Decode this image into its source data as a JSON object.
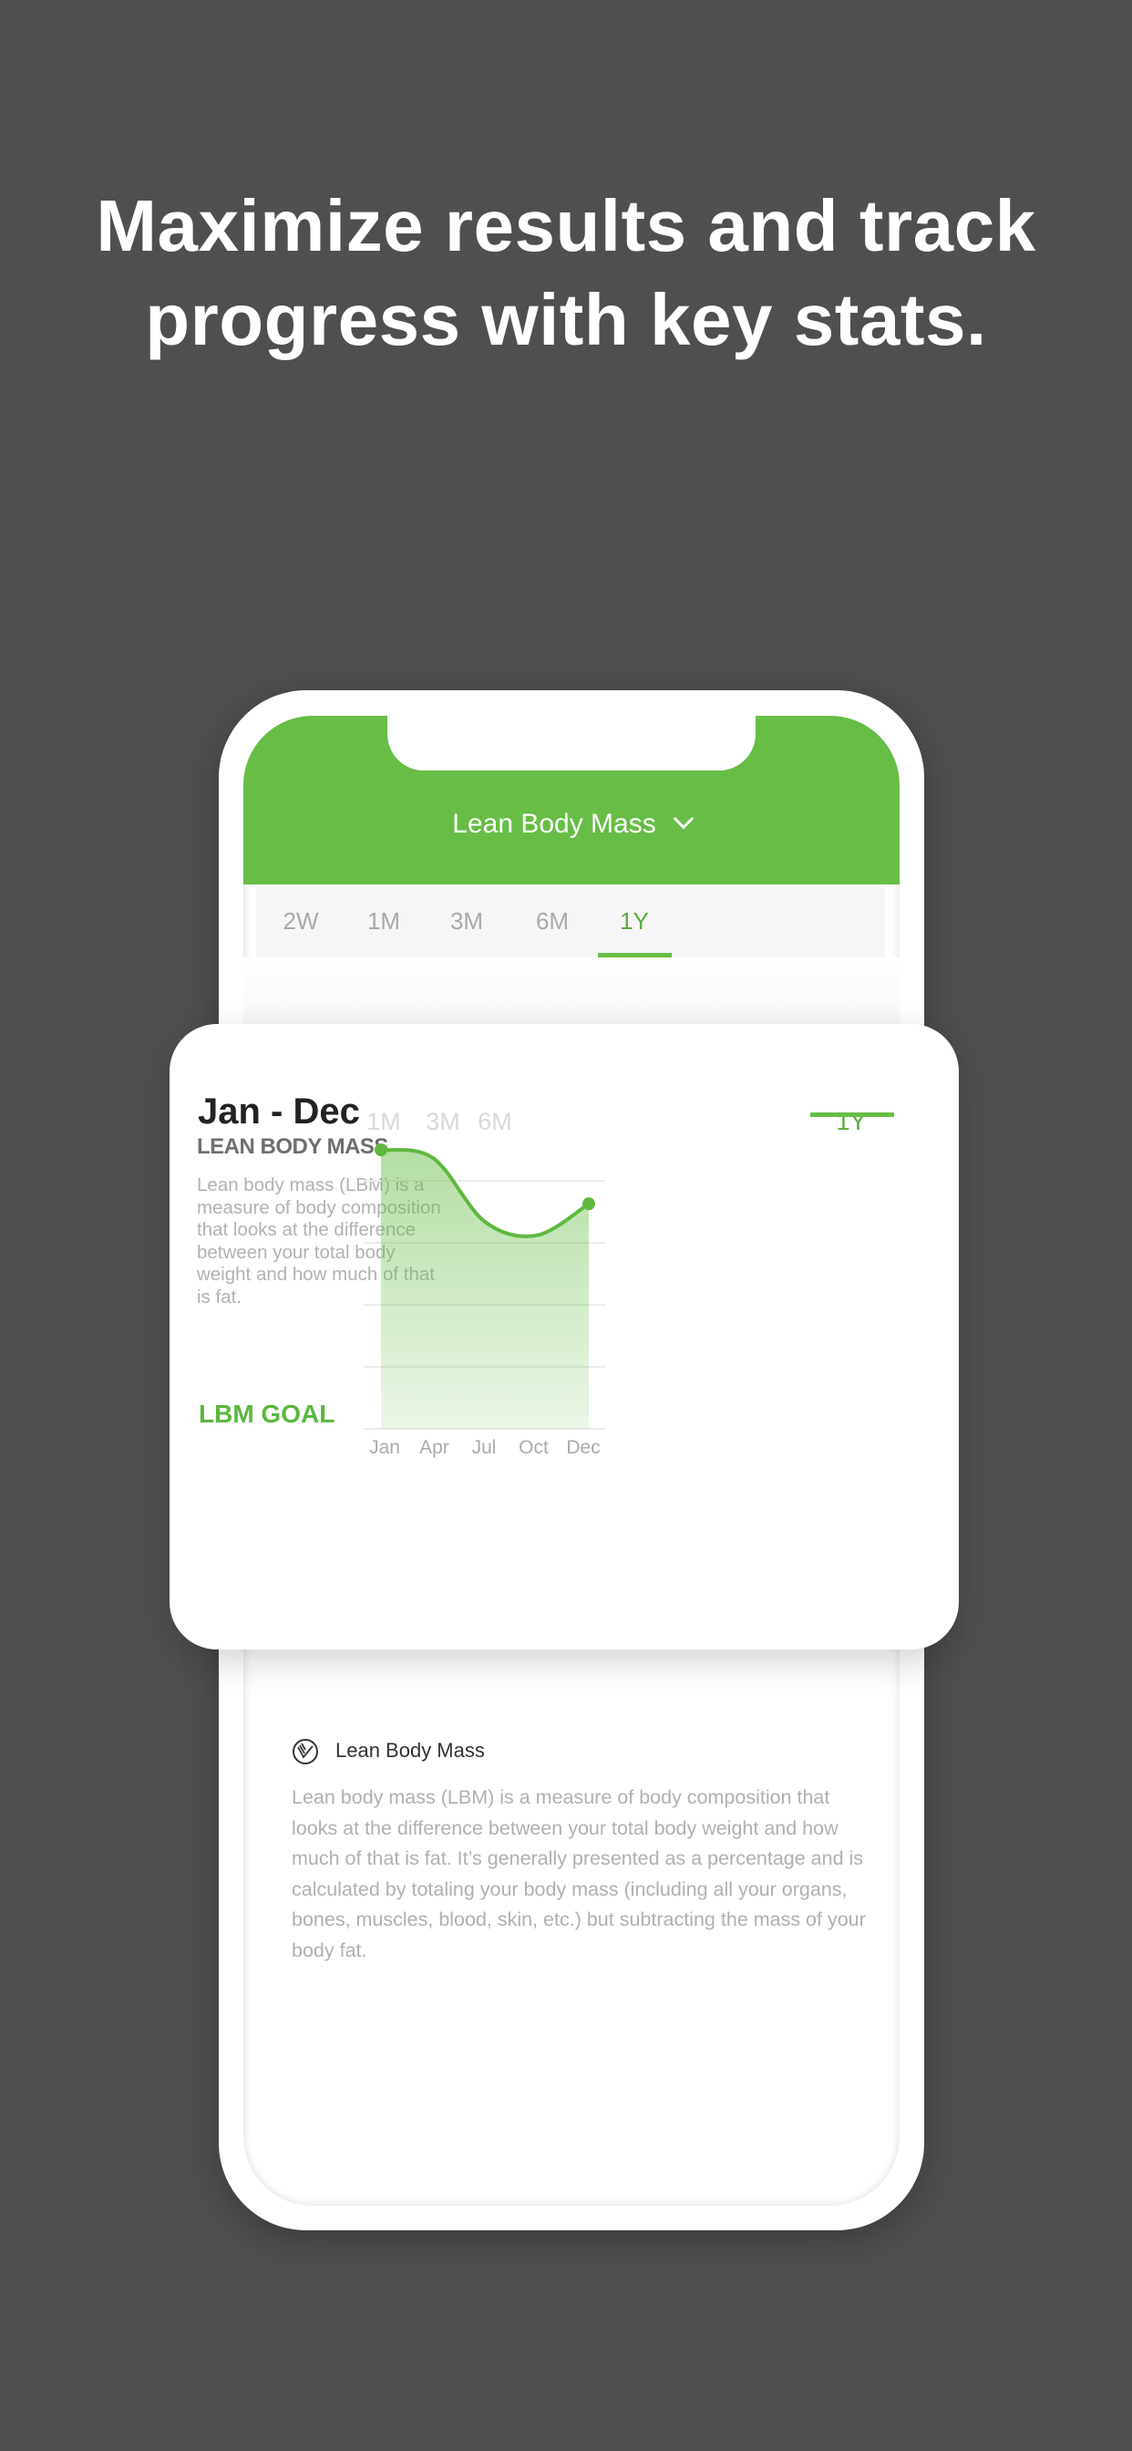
{
  "headline": "Maximize results and track progress with key stats.",
  "header": {
    "title": "Lean Body Mass",
    "dropdown_icon": "chevron-down-icon",
    "accent": "#67bd46"
  },
  "tabs": [
    {
      "label": "2W"
    },
    {
      "label": "1M"
    },
    {
      "label": "3M"
    },
    {
      "label": "6M"
    },
    {
      "label": "1Y",
      "active": true
    }
  ],
  "card": {
    "range": "Jan - Dec",
    "tabs": [
      {
        "label": "1M"
      },
      {
        "label": "3M"
      },
      {
        "label": "6M"
      },
      {
        "label": "1Y",
        "active": true
      }
    ],
    "metric_title": "LEAN BODY MASS",
    "metric_text": "Lean body mass (LBM) is a measure of body composition that looks at the difference between your total body weight and how much of that is fat.",
    "goal_label": "LBM GOAL"
  },
  "chart_data": {
    "type": "area",
    "categories": [
      "Jan",
      "Apr",
      "Jul",
      "Oct",
      "Dec"
    ],
    "values": [
      4.5,
      4.37,
      3.34,
      3.12,
      3.63
    ],
    "ylim": [
      0,
      4.6
    ],
    "grid": true,
    "y_tick_labels_shown": false,
    "color": "#67bd46"
  },
  "info": {
    "icon": "lean-body-mass-icon",
    "title": "Lean Body Mass",
    "text": "Lean body mass (LBM) is a measure of body composition that looks at the difference between your total body weight and how much of that is fat. It’s generally presented as a percentage and is calculated by totaling your body mass (including all your organs, bones, muscles, blood, skin, etc.) but subtracting the mass of your body fat."
  }
}
